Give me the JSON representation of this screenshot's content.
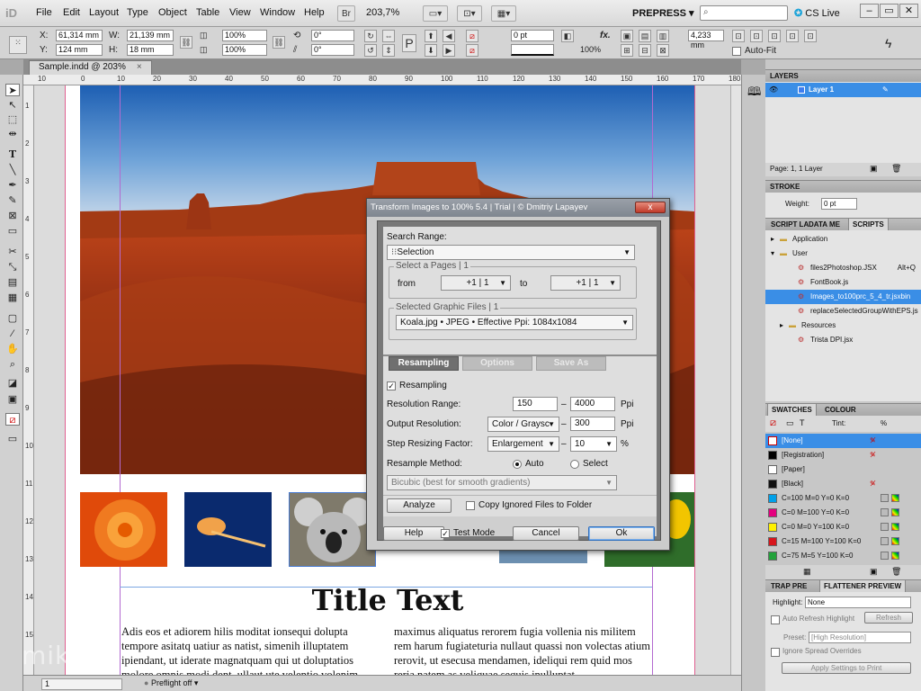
{
  "app": {
    "logo": "iD",
    "document_tab": "Sample.indd @ 203%",
    "tab_close": "×"
  },
  "menu": [
    "File",
    "Edit",
    "Layout",
    "Type",
    "Object",
    "Table",
    "View",
    "Window",
    "Help"
  ],
  "menubar": {
    "bridge_label": "Br",
    "zoom": "203,7%",
    "workspace": "PREPRESS",
    "cs_live": "CS Live",
    "search_placeholder": ""
  },
  "control": {
    "x_label": "X:",
    "x_value": "61,314 mm",
    "y_label": "Y:",
    "y_value": "124 mm",
    "w_label": "W:",
    "w_value": "21,139 mm",
    "h_label": "H:",
    "h_value": "18 mm",
    "scale_x": "100%",
    "scale_y": "100%",
    "rotate": "0°",
    "shear": "0°",
    "stroke_weight": "0 pt",
    "opacity": "100%",
    "ref_point_label": "P",
    "fx_label": "fx.",
    "gap_value": "4,233 mm",
    "autofit_label": "Auto-Fit"
  },
  "rulers": {
    "h": [
      "10",
      "0",
      "10",
      "20",
      "30",
      "40",
      "50",
      "60",
      "70",
      "80",
      "90",
      "100",
      "110",
      "120",
      "130",
      "140",
      "150",
      "160",
      "170",
      "180"
    ],
    "v": [
      "1",
      "2",
      "3",
      "4",
      "5",
      "6",
      "7",
      "8",
      "9",
      "10",
      "11",
      "12",
      "13",
      "14",
      "15"
    ]
  },
  "page": {
    "title": "Title Text",
    "col1": "Adis eos et adiorem hilis moditat ionsequi dolupta tempore asitatq uatiur as natist, simenih illuptatem ipiendant, ut iderate magnatquam qui ut doluptatios molore omnis modi dent, ullaut ute velentio volenim",
    "col2": "maximus aliquatus rerorem fugia vollenia nis militem rem harum fugiateturia nullaut quassi non volectas atium rerovit, ut esecusa mendamen, ideliqui rem quid mos reria natem as veliquae sequis inulluptat"
  },
  "status": {
    "page": "1",
    "preflight": "Preflight off"
  },
  "watermark": "mikeuc",
  "dialog": {
    "title": "Transform Images to 100% 5.4 | Trial | © Dmitriy Lapayev",
    "close": "x",
    "search_range_label": "Search Range:",
    "search_range_value": "Selection",
    "pages_group": "Select a Pages | 1",
    "from_label": "from",
    "from_value": "+1 | 1",
    "to_label": "to",
    "to_value": "+1 | 1",
    "graphic_group": "Selected Graphic Files | 1",
    "graphic_value": "Koala.jpg • JPEG • Effective Ppi: 1084x1084",
    "tabs": [
      "Resampling",
      "Options",
      "Save As"
    ],
    "resampling_check": "Resampling",
    "resolution_range_label": "Resolution Range:",
    "range_min": "150",
    "range_sep": "–",
    "range_max": "4000",
    "ppi": "Ppi",
    "output_label": "Output Resolution:",
    "output_mode": "Color / Graysc",
    "output_value": "300",
    "step_label": "Step Resizing Factor:",
    "step_mode": "Enlargement",
    "step_value": "10",
    "percent": "%",
    "method_label": "Resample Method:",
    "method_auto": "Auto",
    "method_select": "Select",
    "bicubic": "Bicubic (best for smooth gradients)",
    "analyze": "Analyze",
    "copy_ignored": "Copy Ignored Files to Folder",
    "help": "Help",
    "test_mode": "Test Mode",
    "cancel": "Cancel",
    "ok": "Ok"
  },
  "layers": {
    "header": "LAYERS",
    "layer_name": "Layer 1",
    "footer": "Page: 1, 1 Layer"
  },
  "stroke": {
    "header": "STROKE",
    "weight_label": "Weight:",
    "weight_value": "0 pt"
  },
  "scripts": {
    "tabs": [
      "SCRIPT LA",
      "DATA ME",
      "SCRIPTS"
    ],
    "items": [
      {
        "name": "Application",
        "indent": 0,
        "folder": true
      },
      {
        "name": "User",
        "indent": 0,
        "folder": true
      },
      {
        "name": "files2Photoshop.JSX",
        "indent": 2,
        "shortcut": "Alt+Q"
      },
      {
        "name": "FontBook.js",
        "indent": 2
      },
      {
        "name": "Images_to100prc_5_4_tr.jsxbin",
        "indent": 2,
        "selected": true
      },
      {
        "name": "replaceSelectedGroupWithEPS.js",
        "indent": 2
      },
      {
        "name": "Resources",
        "indent": 1,
        "folder": true
      },
      {
        "name": "Trista DPI.jsx",
        "indent": 2
      }
    ]
  },
  "swatches": {
    "tabs": [
      "SWATCHES",
      "COLOUR"
    ],
    "tint_label": "Tint:",
    "tint_unit": "%",
    "items": [
      {
        "name": "[None]",
        "color": "#ffffff",
        "selected": true
      },
      {
        "name": "[Registration]",
        "color": "#000000"
      },
      {
        "name": "[Paper]",
        "color": "#ffffff"
      },
      {
        "name": "[Black]",
        "color": "#111111"
      },
      {
        "name": "C=100 M=0 Y=0 K=0",
        "color": "#00a0e9"
      },
      {
        "name": "C=0 M=100 Y=0 K=0",
        "color": "#e4007f"
      },
      {
        "name": "C=0 M=0 Y=100 K=0",
        "color": "#fff100"
      },
      {
        "name": "C=15 M=100 Y=100 K=0",
        "color": "#d7161c"
      },
      {
        "name": "C=75 M=5 Y=100 K=0",
        "color": "#22a23a"
      }
    ]
  },
  "flattener": {
    "tabs": [
      "TRAP PRE",
      "FLATTENER PREVIEW"
    ],
    "highlight_label": "Highlight:",
    "highlight_value": "None",
    "auto_refresh": "Auto Refresh Highlight",
    "refresh": "Refresh",
    "preset_label": "Preset:",
    "preset_value": "[High Resolution]",
    "ignore_spread": "Ignore Spread Overrides",
    "apply": "Apply Settings to Print"
  }
}
